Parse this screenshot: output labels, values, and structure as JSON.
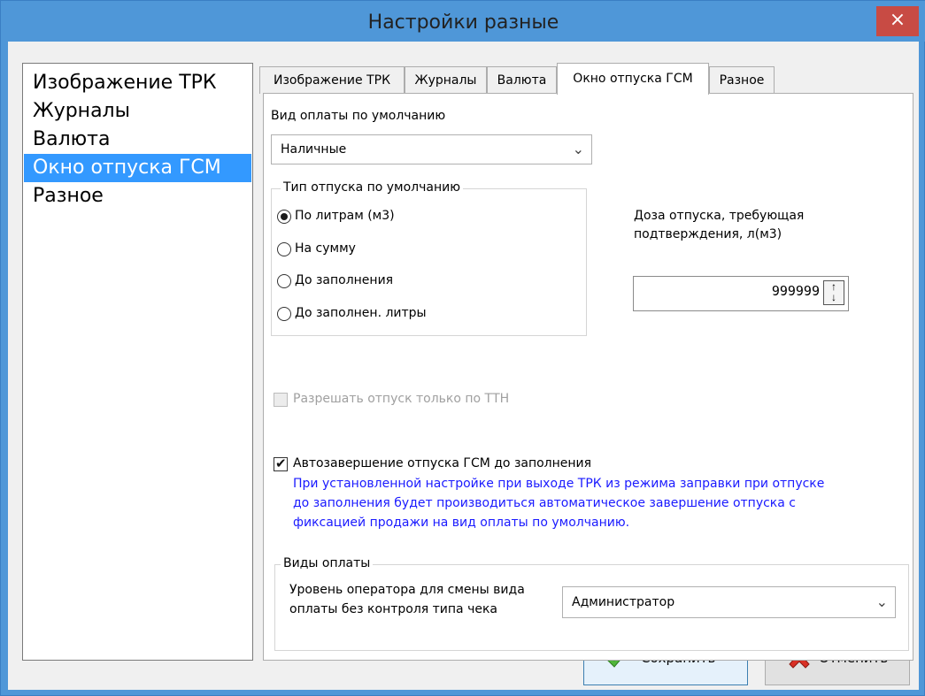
{
  "window": {
    "title": "Настройки разные",
    "close_glyph": "×"
  },
  "nav": {
    "items": [
      {
        "label": "Изображение ТРК",
        "selected": false
      },
      {
        "label": "Журналы",
        "selected": false
      },
      {
        "label": "Валюта",
        "selected": false
      },
      {
        "label": "Окно отпуска ГСМ",
        "selected": true
      },
      {
        "label": "Разное",
        "selected": false
      }
    ]
  },
  "tabs": [
    {
      "label": "Изображение ТРК",
      "active": false
    },
    {
      "label": "Журналы",
      "active": false
    },
    {
      "label": "Валюта",
      "active": false
    },
    {
      "label": "Окно отпуска ГСМ",
      "active": true
    },
    {
      "label": "Разное",
      "active": false
    }
  ],
  "panel": {
    "payment_default_label": "Вид оплаты по умолчанию",
    "payment_default_value": "Наличные",
    "dispense_type_title": "Тип отпуска по умолчанию",
    "dispense_types": [
      {
        "label": "По литрам (м3)",
        "checked": true
      },
      {
        "label": "На сумму",
        "checked": false
      },
      {
        "label": "До заполнения",
        "checked": false
      },
      {
        "label": "До заполнен. литры",
        "checked": false
      }
    ],
    "dose_label_line1": "Доза отпуска, требующая",
    "dose_label_line2": "подтверждения, л(м3)",
    "dose_value": "999999",
    "ttn_label": "Разрешать отпуск только по ТТН",
    "ttn_checked": false,
    "autocomplete_label": "Автозавершение отпуска ГСМ до заполнения",
    "autocomplete_checked": true,
    "autocomplete_hint_line1": "При установленной настройке при выходе ТРК из режима заправки при отпуске",
    "autocomplete_hint_line2": "до заполнения будет производиться автоматическое завершение отпуска с",
    "autocomplete_hint_line3": "фиксацией продажи на вид оплаты по умолчанию.",
    "payment_types_title": "Виды оплаты",
    "operator_level_label_line1": "Уровень оператора для смены вида",
    "operator_level_label_line2": "оплаты без контроля типа чека",
    "operator_level_value": "Администратор"
  },
  "buttons": {
    "save": {
      "label": "Сохранить",
      "icon": "green-check-icon"
    },
    "cancel": {
      "label": "Отменить",
      "icon": "red-x-icon"
    }
  },
  "colors": {
    "titlebar": "#4f97d8",
    "selection": "#3399ff",
    "hint_text": "#1a1aff",
    "close_button": "#c84b44"
  }
}
